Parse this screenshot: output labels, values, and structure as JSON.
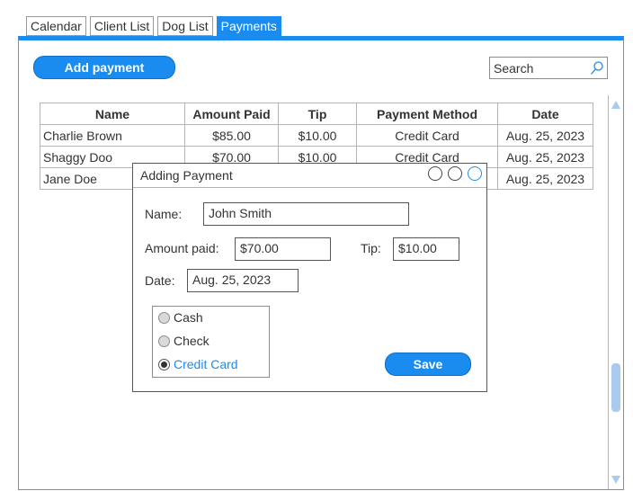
{
  "tabs": [
    {
      "label": "Calendar",
      "active": false
    },
    {
      "label": "Client List",
      "active": false
    },
    {
      "label": "Dog List",
      "active": false
    },
    {
      "label": "Payments",
      "active": true
    }
  ],
  "toolbar": {
    "add_payment_label": "Add payment",
    "search_placeholder": "Search"
  },
  "table": {
    "headers": [
      "Name",
      "Amount Paid",
      "Tip",
      "Payment Method",
      "Date"
    ],
    "rows": [
      {
        "name": "Charlie Brown",
        "amount": "$85.00",
        "tip": "$10.00",
        "method": "Credit Card",
        "date": "Aug. 25, 2023"
      },
      {
        "name": "Shaggy Doo",
        "amount": "$70.00",
        "tip": "$10.00",
        "method": "Credit Card",
        "date": "Aug. 25, 2023"
      },
      {
        "name": "Jane Doe",
        "amount": "",
        "tip": "",
        "method": "",
        "date": "Aug. 25, 2023"
      }
    ]
  },
  "dialog": {
    "title": "Adding Payment",
    "name_label": "Name:",
    "name_value": "John Smith",
    "amount_label": "Amount paid:",
    "amount_value": "$70.00",
    "tip_label": "Tip:",
    "tip_value": "$10.00",
    "date_label": "Date:",
    "date_value": "Aug. 25, 2023",
    "payment_options": [
      {
        "label": "Cash",
        "selected": false
      },
      {
        "label": "Check",
        "selected": false
      },
      {
        "label": "Credit Card",
        "selected": true
      }
    ],
    "save_label": "Save"
  },
  "colors": {
    "accent": "#1a8cf0",
    "scrollbar": "#a9cbef"
  }
}
